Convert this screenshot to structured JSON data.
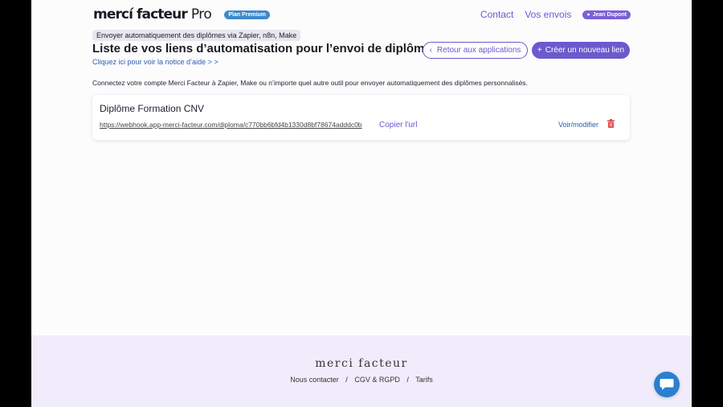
{
  "header": {
    "logo": "mercí facteur",
    "logo_suffix": "Pro",
    "plan_badge": "Plan Premium",
    "nav": [
      {
        "label": "Contact"
      },
      {
        "label": "Vos envois"
      }
    ],
    "user": "Jean Dupont"
  },
  "main": {
    "breadcrumb": "Envoyer automatiquement des diplômes via Zapier, n8n, Make",
    "title": "Liste de vos liens d’automatisation pour l’envoi de diplômes",
    "help_link": "Cliquez ici pour voir la notice d’aide > >",
    "back_button": "Retour aux applications",
    "create_button": "Créer un nouveau lien",
    "intro": "Connectez votre compte Merci Facteur à Zapier, Make ou n’importe quel autre outil pour envoyer automatiquement des diplômes personnalisés.",
    "links": [
      {
        "title": "Diplôme Formation CNV",
        "url": "https://webhook.app-merci-facteur.com/diploma/c770bb6bfd4b1330d8bf78674adddc0b",
        "copy_label": "Copier l'url",
        "view_label": "Voir/modifier"
      }
    ]
  },
  "footer": {
    "logo": "merci facteur",
    "links": [
      "Nous contacter",
      "CGV & RGPD",
      "Tarifs"
    ],
    "separator": "/"
  },
  "colors": {
    "accent": "#6a5acd",
    "link": "#2a5fb0",
    "plan_badge": "#3e8acc",
    "delete": "#e04848",
    "footer_bg": "#f1ecfb",
    "chat": "#2b7fd0"
  },
  "icons": {
    "back": "chevron-left-icon",
    "create": "plus-icon",
    "user": "user-icon",
    "delete": "trash-icon",
    "chat": "chat-bubble-icon"
  }
}
